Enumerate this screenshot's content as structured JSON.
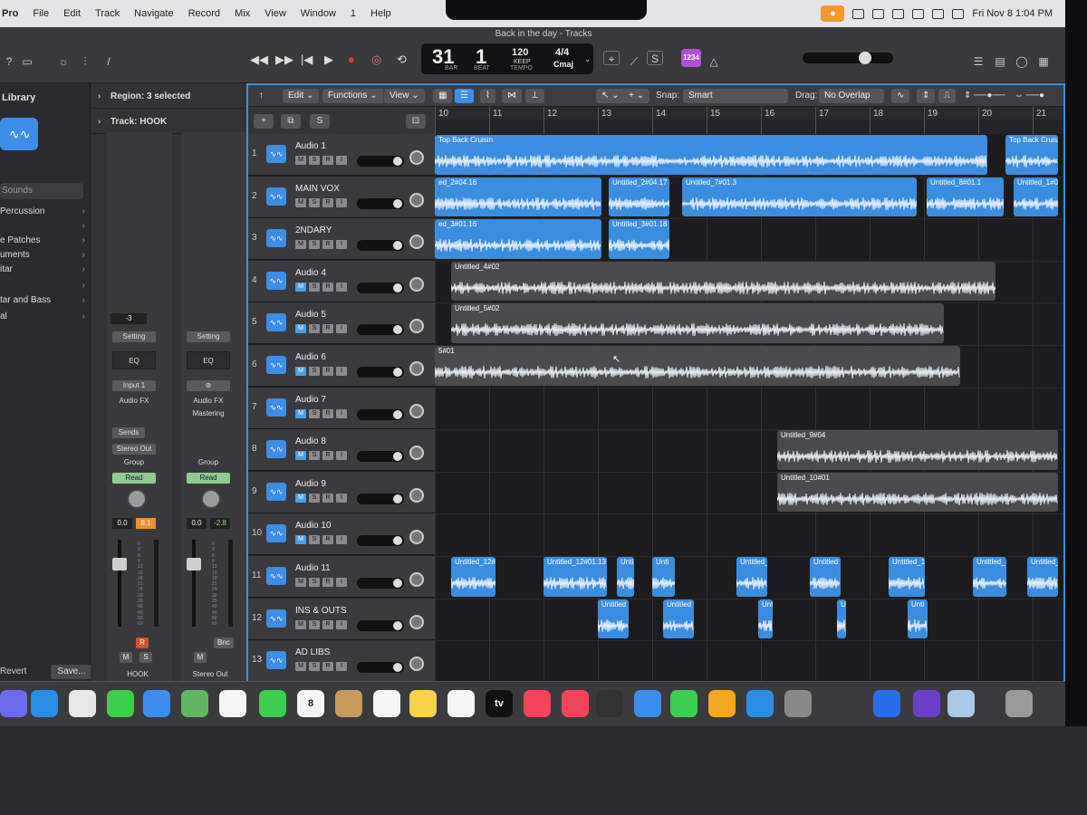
{
  "menubar": {
    "app": "Pro",
    "items": [
      "File",
      "Edit",
      "Track",
      "Navigate",
      "Record",
      "Mix",
      "View",
      "Window",
      "1",
      "Help"
    ],
    "datetime": "Fri Nov 8  1:04 PM"
  },
  "window": {
    "title": "Back in the day - Tracks"
  },
  "lcd": {
    "bar": "31",
    "beat": "1",
    "bar_label": "BAR",
    "beat_label": "BEAT",
    "tempo": "120",
    "tempo_keep": "KEEP",
    "tempo_label": "TEMPO",
    "signature": "4/4",
    "key": "Cmaj"
  },
  "badge": "1234",
  "library": {
    "title": "Library",
    "search_placeholder": "Sounds",
    "items": [
      "Percussion",
      "",
      "e Patches",
      "uments",
      "itar",
      "",
      "tar and Bass",
      "al"
    ],
    "revert": "Revert",
    "save": "Save..."
  },
  "inspector": {
    "region": "Region: 3 selected",
    "track": "Track: HOOK",
    "strip1": {
      "gain": "-3",
      "setting": "Setting",
      "eq": "EQ",
      "input": "Input 1",
      "audio_fx": "Audio FX",
      "sends": "Sends",
      "output": "Stereo Out",
      "group": "Group",
      "automation": "Read",
      "vol": "0.0",
      "peak": "8.1",
      "name": "HOOK"
    },
    "strip2": {
      "setting": "Setting",
      "eq": "EQ",
      "audio_fx": "Audio FX",
      "fx_plugin": "Mastering",
      "group": "Group",
      "automation": "Read",
      "vol": "0.0",
      "peak": "-2.8",
      "bnc": "Bnc",
      "name": "Stereo Out"
    },
    "meter_scale": [
      "0",
      "3",
      "6",
      "9",
      "12",
      "15",
      "18",
      "21",
      "24",
      "30",
      "35",
      "40",
      "45",
      "50",
      "60"
    ]
  },
  "toolbar": {
    "edit": "Edit",
    "functions": "Functions",
    "view": "View",
    "snap_label": "Snap:",
    "snap": "Smart",
    "drag_label": "Drag:",
    "drag": "No Overlap"
  },
  "header_buttons": {
    "add": "+",
    "s": "S"
  },
  "ruler": {
    "bars": [
      "10",
      "11",
      "12",
      "13",
      "14",
      "15",
      "16",
      "17",
      "18",
      "19",
      "20",
      "21"
    ]
  },
  "tracks": [
    {
      "num": "1",
      "name": "Audio 1"
    },
    {
      "num": "2",
      "name": "MAIN VOX"
    },
    {
      "num": "3",
      "name": "2NDARY"
    },
    {
      "num": "4",
      "name": "Audio 4"
    },
    {
      "num": "5",
      "name": "Audio 5"
    },
    {
      "num": "6",
      "name": "Audio 6"
    },
    {
      "num": "7",
      "name": "Audio 7"
    },
    {
      "num": "8",
      "name": "Audio 8"
    },
    {
      "num": "9",
      "name": "Audio 9"
    },
    {
      "num": "10",
      "name": "Audio 10"
    },
    {
      "num": "11",
      "name": "Audio 11"
    },
    {
      "num": "12",
      "name": "INS & OUTS"
    },
    {
      "num": "13",
      "name": "AD LIBS"
    }
  ],
  "regions": [
    {
      "track": 0,
      "start": 0.0,
      "end": 10.2,
      "label": "Top Back Cruisin",
      "color": "blue"
    },
    {
      "track": 0,
      "start": 10.5,
      "end": 11.5,
      "label": "Top Back Cruisin",
      "color": "blue"
    },
    {
      "track": 1,
      "start": 0.0,
      "end": 3.1,
      "label": "ed_2#04.16",
      "color": "blue"
    },
    {
      "track": 1,
      "start": 3.2,
      "end": 4.35,
      "label": "Untitled_2#04.17",
      "color": "blue"
    },
    {
      "track": 1,
      "start": 4.55,
      "end": 8.9,
      "label": "Untitled_7#01.3",
      "color": "blue"
    },
    {
      "track": 1,
      "start": 9.05,
      "end": 10.5,
      "label": "Untitled_8#01.1",
      "color": "blue"
    },
    {
      "track": 1,
      "start": 10.65,
      "end": 11.5,
      "label": "Untitled_1#0",
      "color": "blue"
    },
    {
      "track": 2,
      "start": 0.0,
      "end": 3.1,
      "label": "ed_3#01.16",
      "color": "blue"
    },
    {
      "track": 2,
      "start": 3.2,
      "end": 4.35,
      "label": "Untitled_3#01.18",
      "color": "blue"
    },
    {
      "track": 3,
      "start": 0.3,
      "end": 10.35,
      "label": "Untitled_4#02",
      "color": "grey"
    },
    {
      "track": 4,
      "start": 0.3,
      "end": 9.4,
      "label": "Untitled_5#02",
      "color": "grey"
    },
    {
      "track": 5,
      "start": 0.0,
      "end": 9.7,
      "label": "5#01",
      "color": "grey"
    },
    {
      "track": 7,
      "start": 6.3,
      "end": 11.5,
      "label": "Untitled_9#04",
      "color": "grey"
    },
    {
      "track": 8,
      "start": 6.3,
      "end": 11.5,
      "label": "Untitled_10#01",
      "color": "grey"
    },
    {
      "track": 10,
      "start": 0.3,
      "end": 1.15,
      "label": "Untitled_12#",
      "color": "blue"
    },
    {
      "track": 10,
      "start": 2.0,
      "end": 3.2,
      "label": "Untitled_12#01.13",
      "color": "blue"
    },
    {
      "track": 10,
      "start": 3.35,
      "end": 3.7,
      "label": "Unti",
      "color": "blue"
    },
    {
      "track": 10,
      "start": 4.0,
      "end": 4.45,
      "label": "Unti",
      "color": "blue"
    },
    {
      "track": 10,
      "start": 5.55,
      "end": 6.15,
      "label": "Untitled_",
      "color": "blue"
    },
    {
      "track": 10,
      "start": 6.9,
      "end": 7.5,
      "label": "Untitled",
      "color": "blue"
    },
    {
      "track": 10,
      "start": 8.35,
      "end": 9.05,
      "label": "Untitled_1",
      "color": "blue"
    },
    {
      "track": 10,
      "start": 9.9,
      "end": 10.55,
      "label": "Untitled_",
      "color": "blue"
    },
    {
      "track": 10,
      "start": 10.9,
      "end": 11.5,
      "label": "Untitled_12",
      "color": "blue"
    },
    {
      "track": 11,
      "start": 3.0,
      "end": 3.6,
      "label": "Untitled",
      "color": "blue"
    },
    {
      "track": 11,
      "start": 4.2,
      "end": 4.8,
      "label": "Untitled",
      "color": "blue"
    },
    {
      "track": 11,
      "start": 5.95,
      "end": 6.25,
      "label": "Unti",
      "color": "blue"
    },
    {
      "track": 11,
      "start": 7.4,
      "end": 7.6,
      "label": "U",
      "color": "blue"
    },
    {
      "track": 11,
      "start": 8.7,
      "end": 9.1,
      "label": "Unti",
      "color": "blue"
    }
  ],
  "dock": {
    "items": [
      {
        "name": "launchpad",
        "color": "#6b6bf0"
      },
      {
        "name": "safari",
        "color": "#2a8de8"
      },
      {
        "name": "chrome",
        "color": "#e8e8e8"
      },
      {
        "name": "messages",
        "color": "#3ccf4e"
      },
      {
        "name": "mail",
        "color": "#3b8ef0"
      },
      {
        "name": "maps",
        "color": "#5fb85f"
      },
      {
        "name": "photos",
        "color": "#f5f5f5"
      },
      {
        "name": "facetime",
        "color": "#3ccf4e"
      },
      {
        "name": "calendar",
        "color": "#f5f5f5",
        "label": "8"
      },
      {
        "name": "contacts",
        "color": "#c89a5a"
      },
      {
        "name": "reminders",
        "color": "#f5f5f5"
      },
      {
        "name": "notes",
        "color": "#f7d24a"
      },
      {
        "name": "freeform",
        "color": "#f5f5f5"
      },
      {
        "name": "tv",
        "color": "#111111",
        "label": "tv"
      },
      {
        "name": "music",
        "color": "#f2445a"
      },
      {
        "name": "news",
        "color": "#f2445a"
      },
      {
        "name": "logic-pro",
        "color": "#333333"
      },
      {
        "name": "keynote",
        "color": "#3b8ef0"
      },
      {
        "name": "numbers",
        "color": "#3ccf4e"
      },
      {
        "name": "pages",
        "color": "#f5a623"
      },
      {
        "name": "app-store",
        "color": "#2a8de8"
      },
      {
        "name": "system-settings",
        "color": "#888888"
      },
      {
        "name": "dropbox",
        "color": "#2a6de8"
      },
      {
        "name": "imovie",
        "color": "#6b3fc8"
      },
      {
        "name": "preview",
        "color": "#aac8e8"
      },
      {
        "name": "trash",
        "color": "#999999"
      }
    ]
  }
}
